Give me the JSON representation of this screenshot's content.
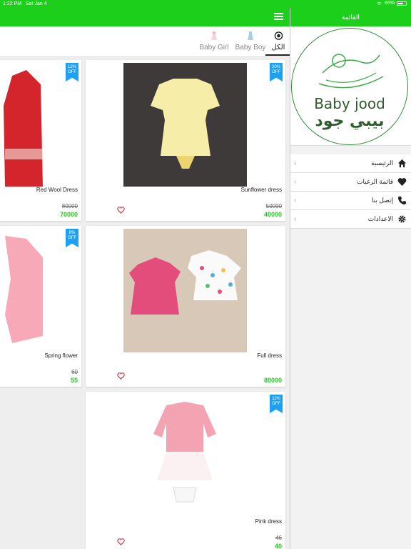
{
  "status": {
    "time": "1:22 PM",
    "date": "Sat Jan 4",
    "battery": "66%"
  },
  "tabs": [
    {
      "label": "الكل",
      "icon": "target-icon",
      "active": true
    },
    {
      "label": "Baby Boy",
      "icon": "boy-dress-icon",
      "active": false
    },
    {
      "label": "Baby Girl",
      "icon": "girl-dress-icon",
      "active": false
    }
  ],
  "products": [
    {
      "name": "Red Wool Dress",
      "old_price": "80000",
      "price": "70000",
      "badge_pct": "12%",
      "badge_off": "OFF"
    },
    {
      "name": "Sunflower dress",
      "old_price": "50000",
      "price": "40000",
      "badge_pct": "20%",
      "badge_off": "OFF"
    },
    {
      "name": "Spring flower",
      "old_price": "60",
      "price": "55",
      "badge_pct": "8%",
      "badge_off": "OFF"
    },
    {
      "name": "Full dress",
      "old_price": "",
      "price": "80000",
      "badge_pct": "",
      "badge_off": ""
    },
    {
      "name": "Pink dress",
      "old_price": "46",
      "price": "40",
      "badge_pct": "11%",
      "badge_off": "OFF"
    }
  ],
  "drawer": {
    "title": "القائمة",
    "logo_en": "Baby jood",
    "logo_ar": "بيبي جود",
    "items": [
      {
        "label": "الرئيسية",
        "icon": "home-icon"
      },
      {
        "label": "قائمة الرغبات",
        "icon": "heart-icon"
      },
      {
        "label": "إتصل بنا",
        "icon": "phone-icon"
      },
      {
        "label": "الاعدادات",
        "icon": "gear-icon"
      }
    ]
  },
  "colors": {
    "primary": "#1ccf1a",
    "badge": "#1ea1f2",
    "heart": "#e0243a"
  }
}
